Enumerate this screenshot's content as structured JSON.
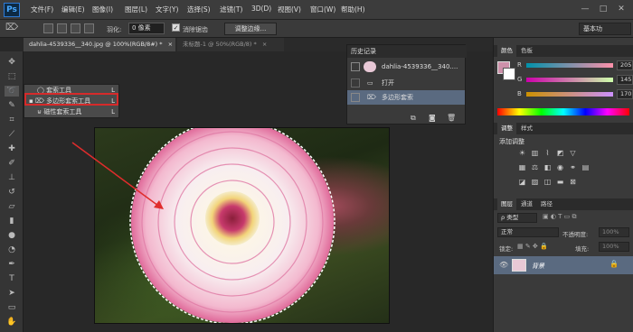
{
  "app": {
    "logo": "Ps"
  },
  "menu": [
    "文件(F)",
    "编辑(E)",
    "图像(I)",
    "图层(L)",
    "文字(Y)",
    "选择(S)",
    "滤镜(T)",
    "3D(D)",
    "视图(V)",
    "窗口(W)",
    "帮助(H)"
  ],
  "window_controls": [
    "—",
    "□",
    "✕"
  ],
  "options": {
    "feather_label": "羽化:",
    "feather_value": "0 像素",
    "antialias_label": "消除锯齿",
    "refine_label": "调整边缘...",
    "workspace": "基本功"
  },
  "tabs": [
    {
      "label": "dahlia-4539336__340.jpg @ 100%(RGB/8#) *",
      "close": "×",
      "active": true
    },
    {
      "label": "未标题-1 @ 50%(RGB/8) *",
      "close": "×",
      "active": false
    }
  ],
  "flyout": {
    "items": [
      {
        "label": "套索工具",
        "key": "L",
        "selected": false
      },
      {
        "label": "多边形套索工具",
        "key": "L",
        "selected": true
      },
      {
        "label": "磁性套索工具",
        "key": "L",
        "selected": false
      }
    ]
  },
  "history": {
    "title": "历史记录",
    "snapshot": "dahlia-4539336__340....",
    "steps": [
      "打开",
      "多边形套索"
    ]
  },
  "color_panel": {
    "tabs": [
      "颜色",
      "色板"
    ],
    "channels": [
      {
        "name": "R",
        "value": "205"
      },
      {
        "name": "G",
        "value": "145"
      },
      {
        "name": "B",
        "value": "170"
      }
    ],
    "foreground": "#cd91aa"
  },
  "adjustments": {
    "tabs": [
      "调整",
      "样式"
    ],
    "title": "添加调整"
  },
  "layers": {
    "tabs": [
      "图层",
      "通道",
      "路径"
    ],
    "kind_label": "ρ 类型",
    "blend_mode": "正常",
    "opacity_label": "不透明度:",
    "opacity_value": "100%",
    "lock_label": "锁定:",
    "fill_label": "填充:",
    "fill_value": "100%",
    "layer_name": "背景"
  }
}
